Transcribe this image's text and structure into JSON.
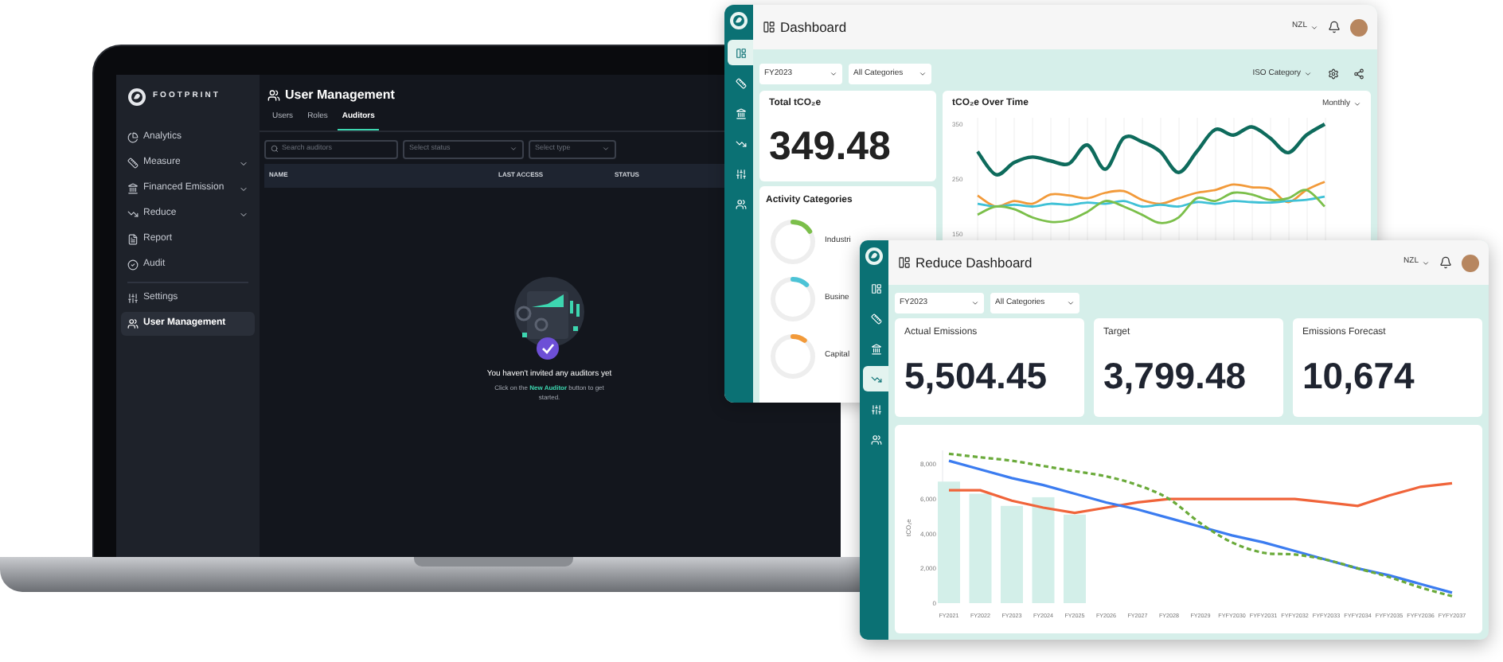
{
  "laptop_app": {
    "brand": "FOOTPRINT",
    "nav": [
      {
        "label": "Analytics",
        "expandable": false,
        "selected": false
      },
      {
        "label": "Measure",
        "expandable": true,
        "selected": false
      },
      {
        "label": "Financed Emission",
        "expandable": true,
        "selected": false
      },
      {
        "label": "Reduce",
        "expandable": true,
        "selected": false
      },
      {
        "label": "Report",
        "expandable": false,
        "selected": false
      },
      {
        "label": "Audit",
        "expandable": false,
        "selected": false
      },
      {
        "label": "Settings",
        "expandable": false,
        "selected": false
      },
      {
        "label": "User Management",
        "expandable": false,
        "selected": true
      }
    ],
    "page_title": "User Management",
    "tabs": [
      {
        "label": "Users",
        "selected": false
      },
      {
        "label": "Roles",
        "selected": false
      },
      {
        "label": "Auditors",
        "selected": true
      }
    ],
    "search": {
      "placeholder": "Search auditors"
    },
    "filters": [
      {
        "placeholder": "Select status"
      },
      {
        "placeholder": "Select type"
      }
    ],
    "columns": [
      "NAME",
      "LAST ACCESS",
      "STATUS"
    ],
    "empty_state": {
      "title": "You haven't invited any auditors yet",
      "message_before": "Click on the",
      "link": "New Auditor",
      "message_after": "button to get started."
    }
  },
  "dashboard": {
    "title": "Dashboard",
    "region": "NZL",
    "rail": [
      {
        "selected": true
      },
      {
        "selected": false
      },
      {
        "selected": false
      },
      {
        "selected": false
      },
      {
        "selected": false
      },
      {
        "selected": false
      }
    ],
    "filters": [
      "FY2023",
      "All Categories"
    ],
    "group_by": "ISO Category",
    "total": {
      "label": "Total tCO₂e",
      "value": "349.48"
    },
    "over_time": {
      "title": "tCO₂e Over Time",
      "period": "Monthly",
      "chart_data": {
        "type": "line",
        "grid": true,
        "ylim": [
          150,
          350
        ],
        "yticks": [
          150,
          250,
          350
        ],
        "series": [
          {
            "color": "#0e6b5c",
            "values": [
              300,
              258,
              280,
              290,
              283,
              278,
              312,
              268,
              325,
              318,
              300,
              262,
              300,
              340,
              330,
              345,
              325,
              298,
              330,
              350
            ]
          },
          {
            "color": "#f29a3a",
            "values": [
              220,
              200,
              210,
              205,
              222,
              220,
              215,
              225,
              228,
              212,
              205,
              215,
              225,
              230,
              240,
              235,
              232,
              208,
              230,
              245
            ]
          },
          {
            "color": "#3fc1d6",
            "values": [
              205,
              200,
              203,
              200,
              205,
              203,
              207,
              205,
              210,
              200,
              203,
              200,
              208,
              205,
              210,
              208,
              207,
              210,
              212,
              218
            ]
          },
          {
            "color": "#7bbf4a",
            "values": [
              185,
              200,
              195,
              180,
              172,
              175,
              190,
              210,
              200,
              185,
              170,
              180,
              215,
              210,
              225,
              222,
              212,
              215,
              230,
              200
            ]
          }
        ]
      }
    },
    "activity": {
      "title": "Activity Categories",
      "items": [
        {
          "label": "Industri",
          "level": 0.16,
          "color": "#7bbf4a"
        },
        {
          "label": "Busine",
          "level": 0.12,
          "color": "#4cc3d6"
        },
        {
          "label": "Capital",
          "level": 0.1,
          "color": "#f29a3a"
        }
      ]
    }
  },
  "reduce_dashboard": {
    "title": "Reduce Dashboard",
    "region": "NZL",
    "rail": [
      {
        "selected": false
      },
      {
        "selected": false
      },
      {
        "selected": false
      },
      {
        "selected": true
      },
      {
        "selected": false
      },
      {
        "selected": false
      }
    ],
    "filters": [
      "FY2023",
      "All Categories"
    ],
    "cards": [
      {
        "label": "Actual Emissions",
        "value": "5,504.45"
      },
      {
        "label": "Target",
        "value": "3,799.48"
      },
      {
        "label": "Emissions Forecast",
        "value": "10,674"
      }
    ],
    "chart_data": {
      "type": "bar",
      "stacked": false,
      "ylabel": "tCO₂e",
      "ylim": [
        0,
        8800
      ],
      "categories": [
        "FY2021",
        "FY2022",
        "FY2023",
        "FY2024",
        "FY2025",
        "FY2026",
        "FY2027",
        "FY2028",
        "FY2029",
        "FYFY2030",
        "FYFY2031",
        "FYFY2032",
        "FYFY2033",
        "FYFY2034",
        "FYFY2035",
        "FYFY2036",
        "FYFY2037"
      ],
      "yticks": [
        {
          "value": 0,
          "label": "0"
        },
        {
          "value": 2000,
          "label": "2,000"
        },
        {
          "value": 4000,
          "label": "4,000"
        },
        {
          "value": 6000,
          "label": "6,000"
        },
        {
          "value": 8000,
          "label": "8,000"
        }
      ],
      "series": [
        {
          "type": "bar",
          "color": "#d3efe9",
          "values": [
            7000,
            6300,
            5600,
            6100,
            5100,
            null,
            null,
            null,
            null,
            null,
            null,
            null,
            null,
            null,
            null,
            null,
            null
          ]
        },
        {
          "type": "line",
          "color": "#f0643a",
          "values": [
            6500,
            6500,
            5900,
            5500,
            5200,
            5500,
            5800,
            6000,
            6000,
            6000,
            6000,
            6000,
            5800,
            5600,
            6200,
            6700,
            6900
          ]
        },
        {
          "type": "line",
          "color": "#3b7cf0",
          "values": [
            8200,
            7700,
            7200,
            6800,
            6300,
            5800,
            5400,
            4900,
            4400,
            3900,
            3500,
            3000,
            2500,
            2000,
            1600,
            1100,
            600
          ]
        },
        {
          "type": "line",
          "line_style": "dashed",
          "color": "#6aaa3a",
          "values": [
            8600,
            8400,
            8200,
            7900,
            7600,
            7300,
            6800,
            6000,
            4600,
            3500,
            2900,
            2800,
            2500,
            2000,
            1500,
            900,
            400
          ]
        }
      ]
    }
  }
}
